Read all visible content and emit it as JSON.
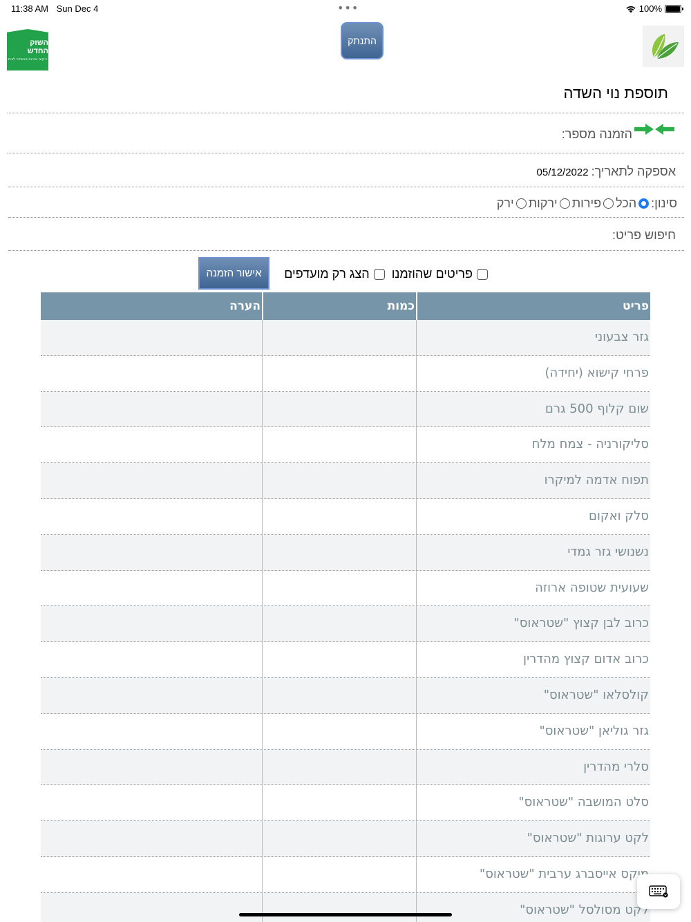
{
  "status": {
    "time": "11:38 AM",
    "date": "Sun Dec 4",
    "battery": "100%"
  },
  "header": {
    "logo_title": "השוק החדש",
    "logo_subtitle": "ירקות ופירות מהשדה לבית",
    "logout_label": "התנתק"
  },
  "page": {
    "title": "תוספת נוי השדה",
    "order_number_label": "הזמנה מספר:",
    "supply_date_label": "אספקה לתאריך:",
    "supply_date_value": "05/12/2022",
    "filter_label": "סינון:",
    "filter_options": [
      "הכל",
      "פירות",
      "ירקות",
      "ירק"
    ],
    "search_label": "חיפוש פריט:",
    "ordered_items_label": "פריטים שהוזמנו",
    "favorites_only_label": "הצג רק מועדפים",
    "confirm_label": "אישור הזמנה"
  },
  "table": {
    "headers": {
      "item": "פריט",
      "quantity": "כמות",
      "note": "הערה"
    },
    "rows": [
      "גזר צבעוני",
      "פרחי קישוא (יחידה)",
      "שום קלוף 500 גרם",
      "סליקורניה - צמח מלח",
      "תפוח אדמה למיקרו",
      "סלק ואקום",
      "נשנושי גזר גמדי",
      "שעועית שטופה ארוזה",
      "כרוב לבן קצוץ \"שטראוס\"",
      "כרוב אדום קצוץ מהדרין",
      "קולסלאו \"שטראוס\"",
      "גזר גוליאן \"שטראוס\"",
      "סלרי מהדרין",
      "סלט המושבה \"שטראוס\"",
      "לקט ערוגות \"שטראוס\"",
      "מיקס אייסברג ערבית \"שטראוס\"",
      "לקט מסולסל \"שטראוס\""
    ]
  },
  "colors": {
    "accent": "#1a7cf5",
    "header_bg": "#7795a8",
    "button": "#4f7199",
    "brand_green": "#22a24a"
  }
}
